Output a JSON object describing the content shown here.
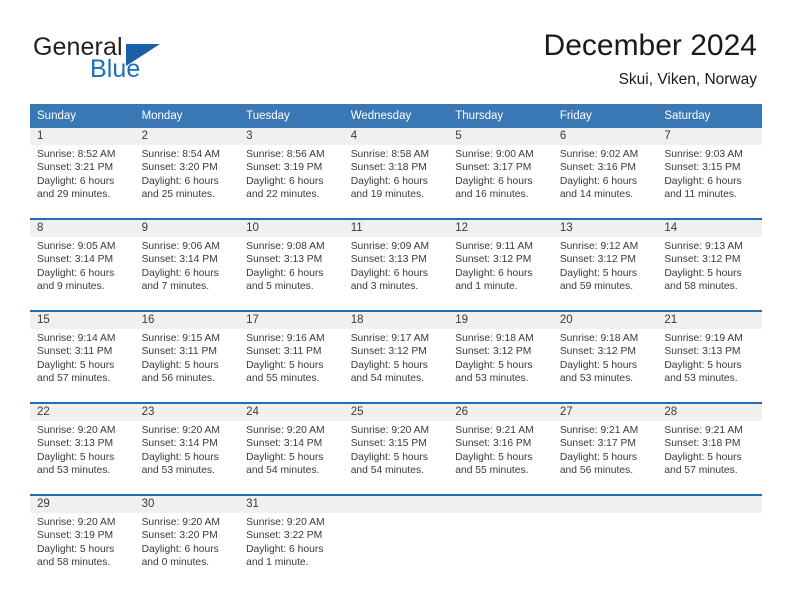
{
  "brand": {
    "name_part1": "General",
    "name_part2": "Blue",
    "logo_icon": "blue-triangle-icon",
    "accent_color": "#1d6fb8"
  },
  "header": {
    "title": "December 2024",
    "location": "Skui, Viken, Norway"
  },
  "calendar": {
    "header_bg": "#3a78b5",
    "daynum_bg": "#f0f0f0",
    "separator_color": "#1d6fb8",
    "weekday_headers": [
      "Sunday",
      "Monday",
      "Tuesday",
      "Wednesday",
      "Thursday",
      "Friday",
      "Saturday"
    ],
    "weeks": [
      [
        {
          "day": "1",
          "sunrise": "Sunrise: 8:52 AM",
          "sunset": "Sunset: 3:21 PM",
          "daylight_line1": "Daylight: 6 hours",
          "daylight_line2": "and 29 minutes."
        },
        {
          "day": "2",
          "sunrise": "Sunrise: 8:54 AM",
          "sunset": "Sunset: 3:20 PM",
          "daylight_line1": "Daylight: 6 hours",
          "daylight_line2": "and 25 minutes."
        },
        {
          "day": "3",
          "sunrise": "Sunrise: 8:56 AM",
          "sunset": "Sunset: 3:19 PM",
          "daylight_line1": "Daylight: 6 hours",
          "daylight_line2": "and 22 minutes."
        },
        {
          "day": "4",
          "sunrise": "Sunrise: 8:58 AM",
          "sunset": "Sunset: 3:18 PM",
          "daylight_line1": "Daylight: 6 hours",
          "daylight_line2": "and 19 minutes."
        },
        {
          "day": "5",
          "sunrise": "Sunrise: 9:00 AM",
          "sunset": "Sunset: 3:17 PM",
          "daylight_line1": "Daylight: 6 hours",
          "daylight_line2": "and 16 minutes."
        },
        {
          "day": "6",
          "sunrise": "Sunrise: 9:02 AM",
          "sunset": "Sunset: 3:16 PM",
          "daylight_line1": "Daylight: 6 hours",
          "daylight_line2": "and 14 minutes."
        },
        {
          "day": "7",
          "sunrise": "Sunrise: 9:03 AM",
          "sunset": "Sunset: 3:15 PM",
          "daylight_line1": "Daylight: 6 hours",
          "daylight_line2": "and 11 minutes."
        }
      ],
      [
        {
          "day": "8",
          "sunrise": "Sunrise: 9:05 AM",
          "sunset": "Sunset: 3:14 PM",
          "daylight_line1": "Daylight: 6 hours",
          "daylight_line2": "and 9 minutes."
        },
        {
          "day": "9",
          "sunrise": "Sunrise: 9:06 AM",
          "sunset": "Sunset: 3:14 PM",
          "daylight_line1": "Daylight: 6 hours",
          "daylight_line2": "and 7 minutes."
        },
        {
          "day": "10",
          "sunrise": "Sunrise: 9:08 AM",
          "sunset": "Sunset: 3:13 PM",
          "daylight_line1": "Daylight: 6 hours",
          "daylight_line2": "and 5 minutes."
        },
        {
          "day": "11",
          "sunrise": "Sunrise: 9:09 AM",
          "sunset": "Sunset: 3:13 PM",
          "daylight_line1": "Daylight: 6 hours",
          "daylight_line2": "and 3 minutes."
        },
        {
          "day": "12",
          "sunrise": "Sunrise: 9:11 AM",
          "sunset": "Sunset: 3:12 PM",
          "daylight_line1": "Daylight: 6 hours",
          "daylight_line2": "and 1 minute."
        },
        {
          "day": "13",
          "sunrise": "Sunrise: 9:12 AM",
          "sunset": "Sunset: 3:12 PM",
          "daylight_line1": "Daylight: 5 hours",
          "daylight_line2": "and 59 minutes."
        },
        {
          "day": "14",
          "sunrise": "Sunrise: 9:13 AM",
          "sunset": "Sunset: 3:12 PM",
          "daylight_line1": "Daylight: 5 hours",
          "daylight_line2": "and 58 minutes."
        }
      ],
      [
        {
          "day": "15",
          "sunrise": "Sunrise: 9:14 AM",
          "sunset": "Sunset: 3:11 PM",
          "daylight_line1": "Daylight: 5 hours",
          "daylight_line2": "and 57 minutes."
        },
        {
          "day": "16",
          "sunrise": "Sunrise: 9:15 AM",
          "sunset": "Sunset: 3:11 PM",
          "daylight_line1": "Daylight: 5 hours",
          "daylight_line2": "and 56 minutes."
        },
        {
          "day": "17",
          "sunrise": "Sunrise: 9:16 AM",
          "sunset": "Sunset: 3:11 PM",
          "daylight_line1": "Daylight: 5 hours",
          "daylight_line2": "and 55 minutes."
        },
        {
          "day": "18",
          "sunrise": "Sunrise: 9:17 AM",
          "sunset": "Sunset: 3:12 PM",
          "daylight_line1": "Daylight: 5 hours",
          "daylight_line2": "and 54 minutes."
        },
        {
          "day": "19",
          "sunrise": "Sunrise: 9:18 AM",
          "sunset": "Sunset: 3:12 PM",
          "daylight_line1": "Daylight: 5 hours",
          "daylight_line2": "and 53 minutes."
        },
        {
          "day": "20",
          "sunrise": "Sunrise: 9:18 AM",
          "sunset": "Sunset: 3:12 PM",
          "daylight_line1": "Daylight: 5 hours",
          "daylight_line2": "and 53 minutes."
        },
        {
          "day": "21",
          "sunrise": "Sunrise: 9:19 AM",
          "sunset": "Sunset: 3:13 PM",
          "daylight_line1": "Daylight: 5 hours",
          "daylight_line2": "and 53 minutes."
        }
      ],
      [
        {
          "day": "22",
          "sunrise": "Sunrise: 9:20 AM",
          "sunset": "Sunset: 3:13 PM",
          "daylight_line1": "Daylight: 5 hours",
          "daylight_line2": "and 53 minutes."
        },
        {
          "day": "23",
          "sunrise": "Sunrise: 9:20 AM",
          "sunset": "Sunset: 3:14 PM",
          "daylight_line1": "Daylight: 5 hours",
          "daylight_line2": "and 53 minutes."
        },
        {
          "day": "24",
          "sunrise": "Sunrise: 9:20 AM",
          "sunset": "Sunset: 3:14 PM",
          "daylight_line1": "Daylight: 5 hours",
          "daylight_line2": "and 54 minutes."
        },
        {
          "day": "25",
          "sunrise": "Sunrise: 9:20 AM",
          "sunset": "Sunset: 3:15 PM",
          "daylight_line1": "Daylight: 5 hours",
          "daylight_line2": "and 54 minutes."
        },
        {
          "day": "26",
          "sunrise": "Sunrise: 9:21 AM",
          "sunset": "Sunset: 3:16 PM",
          "daylight_line1": "Daylight: 5 hours",
          "daylight_line2": "and 55 minutes."
        },
        {
          "day": "27",
          "sunrise": "Sunrise: 9:21 AM",
          "sunset": "Sunset: 3:17 PM",
          "daylight_line1": "Daylight: 5 hours",
          "daylight_line2": "and 56 minutes."
        },
        {
          "day": "28",
          "sunrise": "Sunrise: 9:21 AM",
          "sunset": "Sunset: 3:18 PM",
          "daylight_line1": "Daylight: 5 hours",
          "daylight_line2": "and 57 minutes."
        }
      ],
      [
        {
          "day": "29",
          "sunrise": "Sunrise: 9:20 AM",
          "sunset": "Sunset: 3:19 PM",
          "daylight_line1": "Daylight: 5 hours",
          "daylight_line2": "and 58 minutes."
        },
        {
          "day": "30",
          "sunrise": "Sunrise: 9:20 AM",
          "sunset": "Sunset: 3:20 PM",
          "daylight_line1": "Daylight: 6 hours",
          "daylight_line2": "and 0 minutes."
        },
        {
          "day": "31",
          "sunrise": "Sunrise: 9:20 AM",
          "sunset": "Sunset: 3:22 PM",
          "daylight_line1": "Daylight: 6 hours",
          "daylight_line2": "and 1 minute."
        },
        {
          "day": "",
          "sunrise": "",
          "sunset": "",
          "daylight_line1": "",
          "daylight_line2": ""
        },
        {
          "day": "",
          "sunrise": "",
          "sunset": "",
          "daylight_line1": "",
          "daylight_line2": ""
        },
        {
          "day": "",
          "sunrise": "",
          "sunset": "",
          "daylight_line1": "",
          "daylight_line2": ""
        },
        {
          "day": "",
          "sunrise": "",
          "sunset": "",
          "daylight_line1": "",
          "daylight_line2": ""
        }
      ]
    ]
  }
}
